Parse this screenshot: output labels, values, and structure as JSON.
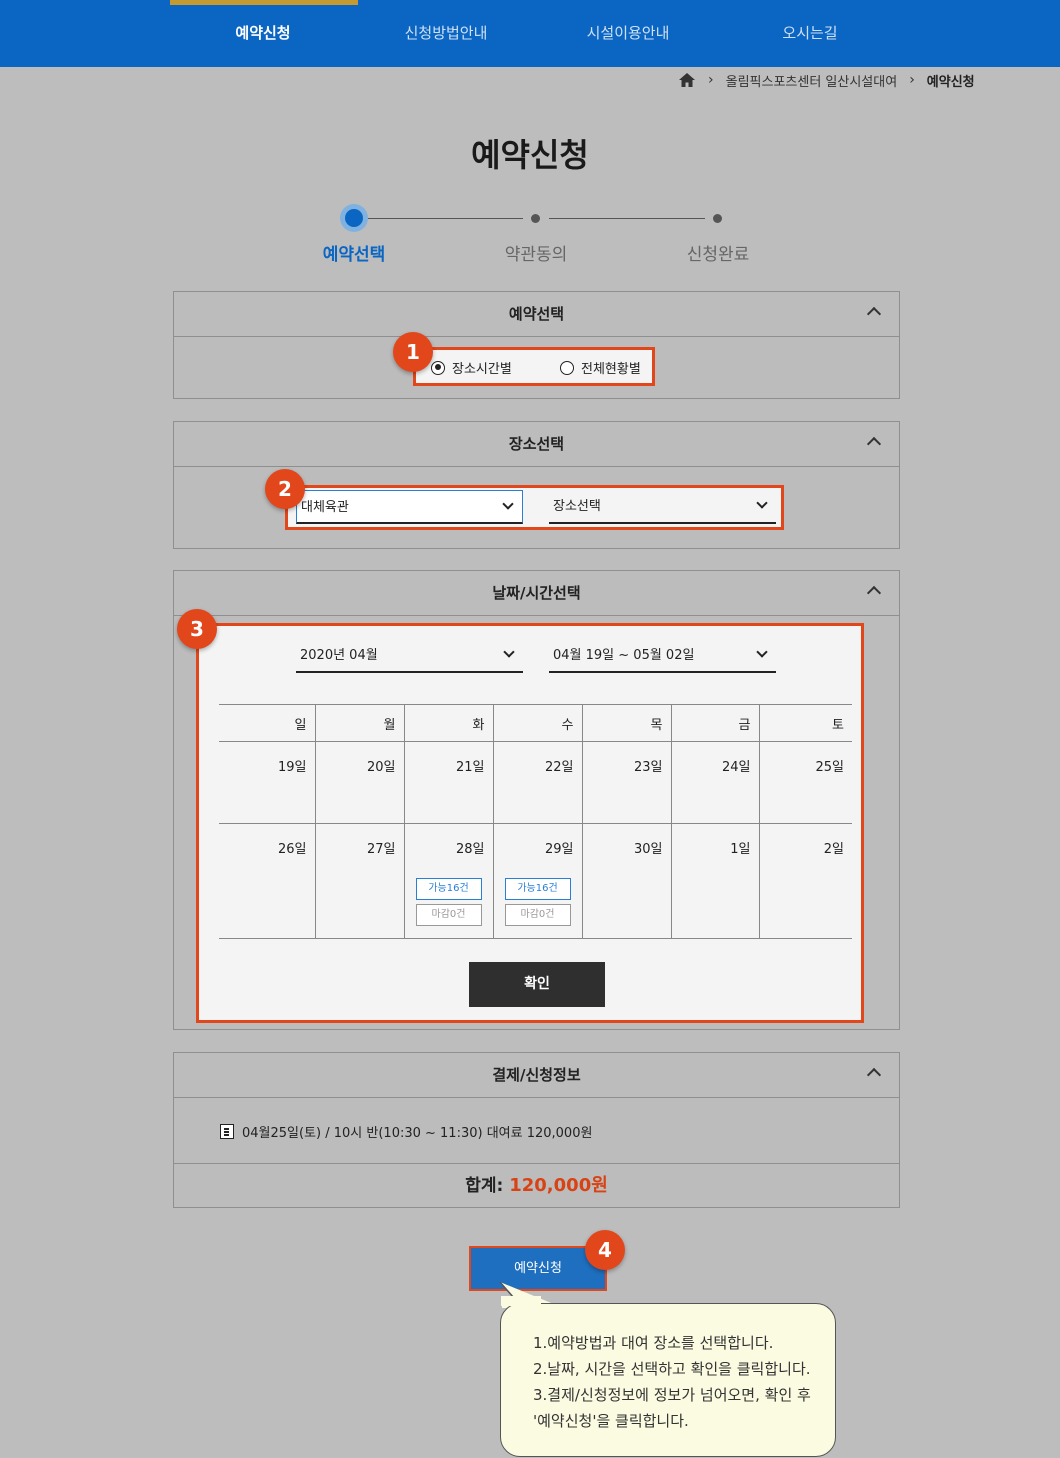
{
  "nav": {
    "items": [
      "예약신청",
      "신청방법안내",
      "시설이용안내",
      "오시는길"
    ]
  },
  "breadcrumb": {
    "home_icon": "home-icon",
    "section": "올림픽스포츠센터 일산시설대여",
    "current": "예약신청"
  },
  "page_title": "예약신청",
  "steps": [
    "예약선택",
    "약관동의",
    "신청완료"
  ],
  "panels": {
    "reserve_select": {
      "title": "예약선택",
      "options": [
        "장소시간별",
        "전체현황별"
      ],
      "selected": "장소시간별"
    },
    "place_select": {
      "title": "장소선택",
      "facility": "대체육관",
      "place_placeholder": "장소선택"
    },
    "datetime": {
      "title": "날짜/시간선택",
      "month": "2020년 04월",
      "week_range": "04월 19일 ~ 05월 02일",
      "weekdays": [
        "일",
        "월",
        "화",
        "수",
        "목",
        "금",
        "토"
      ],
      "week1": [
        "19일",
        "20일",
        "21일",
        "22일",
        "23일",
        "24일",
        "25일"
      ],
      "week2": [
        "26일",
        "27일",
        "28일",
        "29일",
        "30일",
        "1일",
        "2일"
      ],
      "tag_available": "가능16건",
      "tag_closed": "마감0건",
      "confirm": "확인"
    },
    "payment": {
      "title": "결제/신청정보",
      "line": "04월25일(토) / 10시 반(10:30 ~ 11:30) 대여료 120,000원",
      "total_label": "합계:",
      "total_amount": "120,000원"
    }
  },
  "reserve_button": "예약신청",
  "badges": [
    "1",
    "2",
    "3",
    "4"
  ],
  "tooltip": {
    "lines": [
      "1.예약방법과 대여 장소를 선택합니다.",
      "2.날짜, 시간을 선택하고 확인을 클릭합니다.",
      "3.결제/신청정보에 정보가 넘어오면, 확인 후",
      "'예약신청'을 클릭합니다."
    ]
  },
  "colors": {
    "nav_bg": "#0a66c2",
    "highlight": "#e2461b",
    "total_amount": "#d84315",
    "sunday": "#d32f2f"
  }
}
